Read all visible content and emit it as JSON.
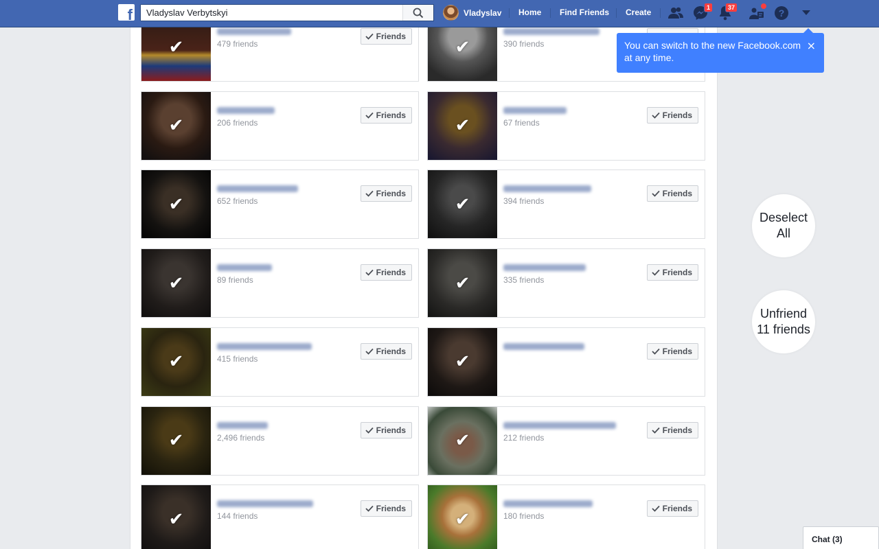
{
  "header": {
    "search_value": "Vladyslav Verbytskyi",
    "user_name": "Vladyslav",
    "home": "Home",
    "find_friends": "Find Friends",
    "create": "Create",
    "messages_badge": "1",
    "notifications_badge": "37"
  },
  "tooltip": {
    "text": "You can switch to the new Facebook.com at any time.",
    "close": "×"
  },
  "friend_button_label": "Friends",
  "cards": [
    {
      "count": "479 friends"
    },
    {
      "count": "390 friends"
    },
    {
      "count": "206 friends"
    },
    {
      "count": "67 friends"
    },
    {
      "count": "652 friends"
    },
    {
      "count": "394 friends"
    },
    {
      "count": "89 friends"
    },
    {
      "count": "335 friends"
    },
    {
      "count": "415 friends"
    },
    {
      "count": ""
    },
    {
      "count": "2,496 friends"
    },
    {
      "count": "212 friends"
    },
    {
      "count": "144 friends"
    },
    {
      "count": "180 friends"
    }
  ],
  "actions": {
    "deselect_all": "Deselect All",
    "unfriend": "Unfriend 11 friends"
  },
  "chat": {
    "label": "Chat (3)"
  },
  "colors": {
    "brand": "#4267b2",
    "tooltip": "#4080ff",
    "badge": "#fa3e3e"
  }
}
